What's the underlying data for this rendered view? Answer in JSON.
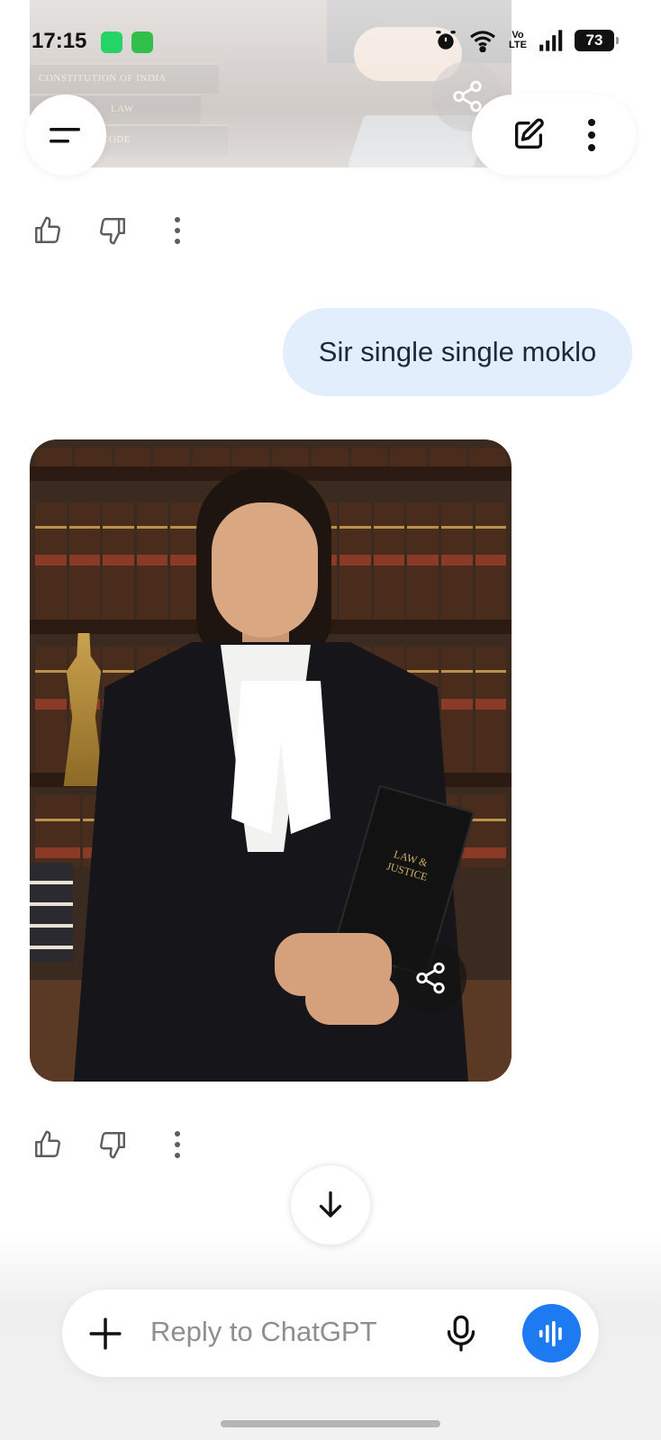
{
  "status_bar": {
    "time": "17:15",
    "network_label": "Vo LTE",
    "battery": "73"
  },
  "header": {
    "menu_icon": "hamburger-menu-icon",
    "new_chat_icon": "edit-icon",
    "more_icon": "more-vertical-icon"
  },
  "top_image": {
    "book_labels": [
      "CONSTITUTION OF INDIA",
      "LAW",
      "CODE"
    ],
    "share_icon": "share-icon"
  },
  "messages": [
    {
      "role": "assistant",
      "type": "image",
      "actions": [
        "thumbs-up-icon",
        "thumbs-down-icon",
        "more-vertical-icon"
      ]
    },
    {
      "role": "user",
      "text": "Sir single single moklo"
    },
    {
      "role": "assistant",
      "type": "image",
      "image_book_text": "LAW & JUSTICE",
      "share_icon": "share-icon",
      "actions": [
        "thumbs-up-icon",
        "thumbs-down-icon",
        "more-vertical-icon"
      ]
    }
  ],
  "scroll_button": {
    "icon": "arrow-down-icon"
  },
  "composer": {
    "placeholder": "Reply to ChatGPT",
    "add_icon": "plus-icon",
    "mic_icon": "microphone-icon",
    "voice_icon": "voice-mode-icon",
    "voice_button_color": "#1e7af0",
    "user_bubble_color": "#e2eefb"
  }
}
